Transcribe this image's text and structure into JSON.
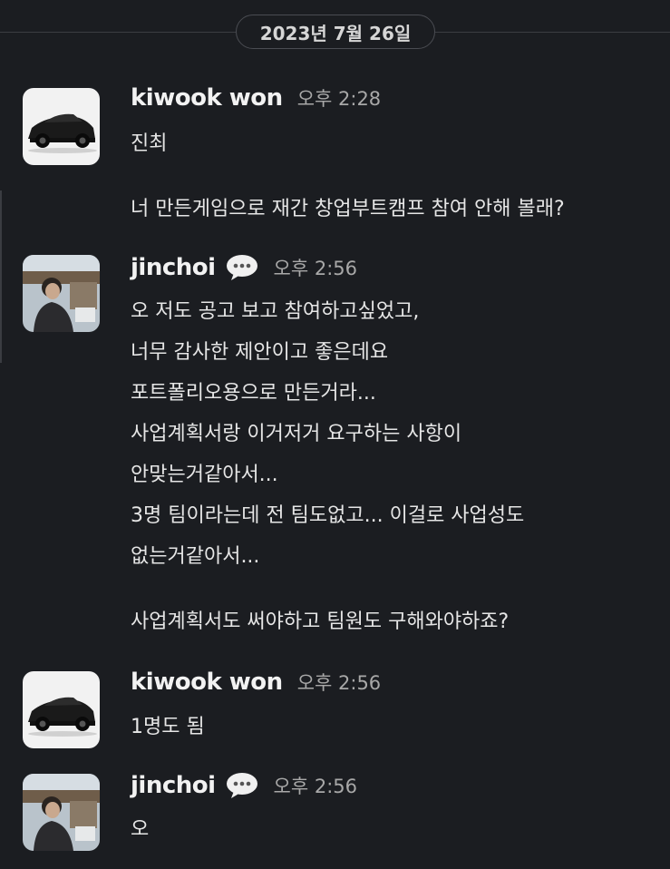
{
  "date_divider": "2023년 7월 26일",
  "messages": [
    {
      "author": "kiwook won",
      "time": "오후 2:28",
      "avatar": "sports-car-photo",
      "lines": [
        "진최",
        "너 만든게임으로 재간 창업부트캠프 참여 안해 볼래?"
      ]
    },
    {
      "author": "jinchoi",
      "time": "오후 2:56",
      "avatar": "person-photo",
      "status_icon": "speech-bubble-icon",
      "lines": [
        "오 저도 공고 보고 참여하고싶었고,",
        "너무 감사한 제안이고 좋은데요",
        "포트폴리오용으로 만든거라...",
        "사업계획서랑 이거저거 요구하는 사항이",
        "안맞는거같아서...",
        "3명 팀이라는데 전 팀도없고... 이걸로 사업성도",
        "없는거같아서...",
        "사업계획서도 써야하고 팀원도 구해와야하죠?"
      ]
    },
    {
      "author": "kiwook won",
      "time": "오후 2:56",
      "avatar": "sports-car-photo",
      "lines": [
        "1명도 됨"
      ]
    },
    {
      "author": "jinchoi",
      "time": "오후 2:56",
      "avatar": "person-photo",
      "status_icon": "speech-bubble-icon",
      "lines": [
        "오"
      ]
    }
  ]
}
